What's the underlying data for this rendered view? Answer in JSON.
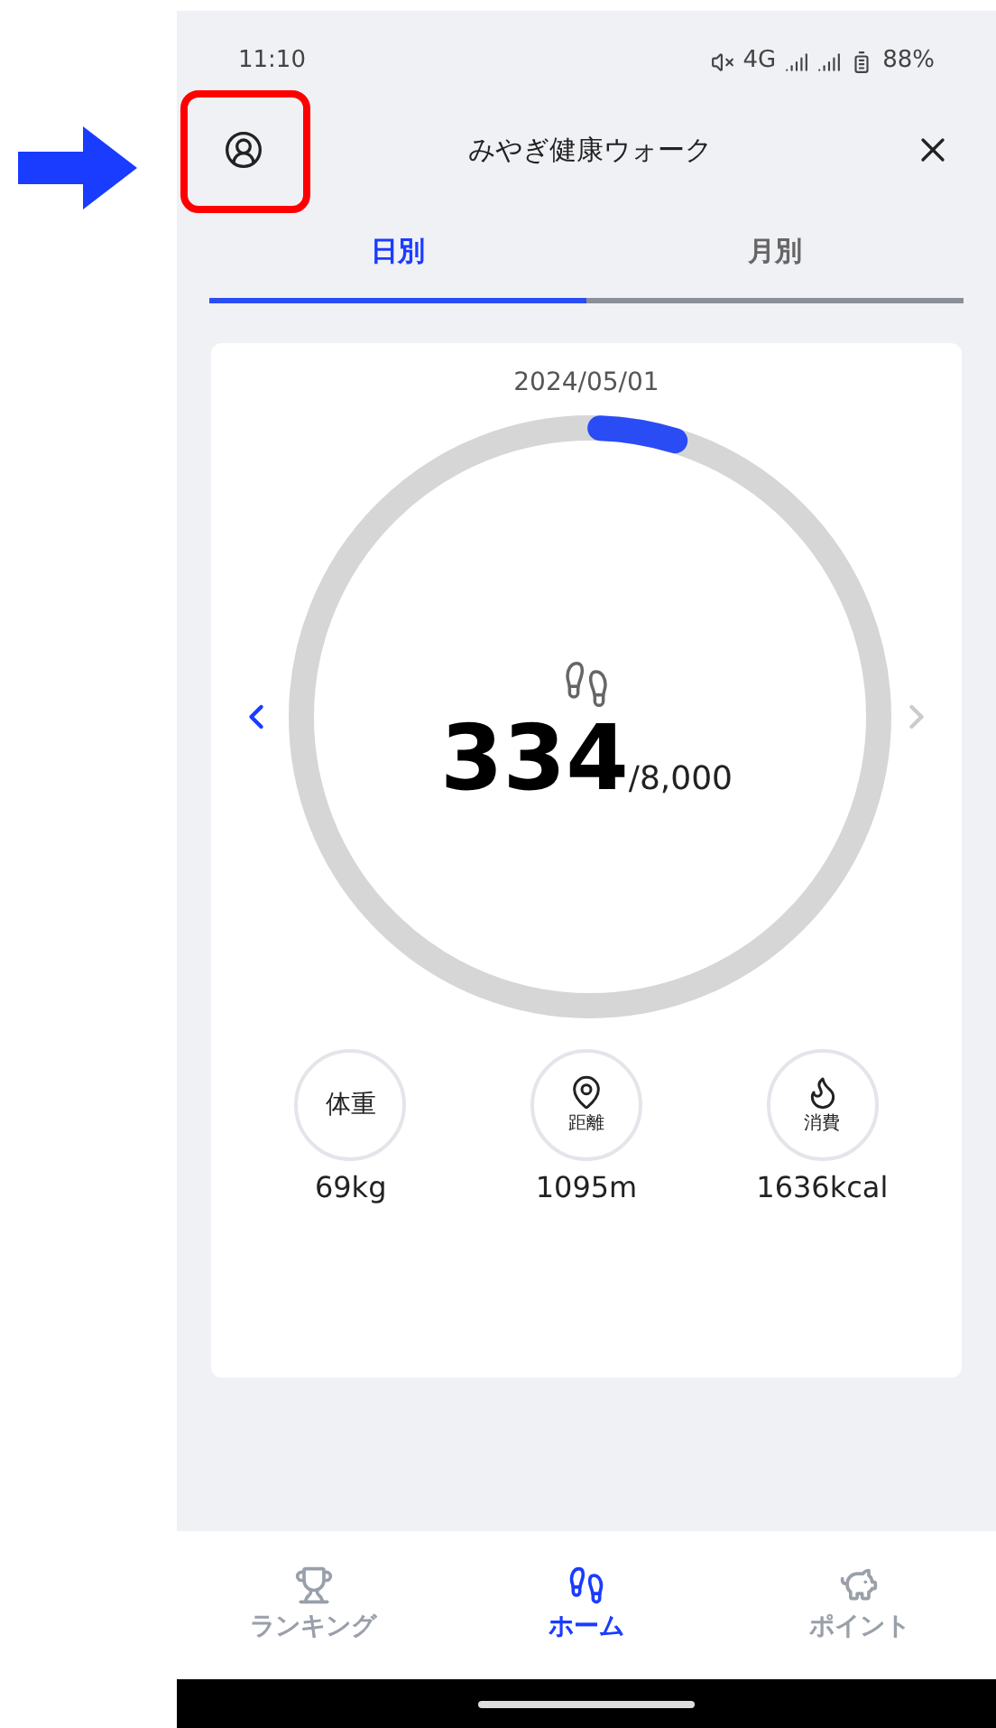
{
  "annotation": {
    "arrow": true,
    "highlight_box": true
  },
  "status_bar": {
    "time": "11:10",
    "network": "4G",
    "battery": "88%",
    "muted": true
  },
  "header": {
    "title": "みやぎ健康ウォーク"
  },
  "tabs": [
    {
      "label": "日別",
      "selected": true
    },
    {
      "label": "月別",
      "selected": false
    }
  ],
  "summary": {
    "date": "2024/05/01",
    "steps": "334",
    "goal": "/8,000",
    "level": 0.042,
    "prev_disabled": false,
    "next_disabled": true
  },
  "stats": [
    {
      "kind": "text",
      "label": "体重",
      "value": "69kg"
    },
    {
      "kind": "distance",
      "label": "距離",
      "value": "1095m"
    },
    {
      "kind": "calories",
      "label": "消費",
      "value": "1636kcal"
    }
  ],
  "bottom_nav": [
    {
      "kind": "ranking",
      "label": "ランキング",
      "selected": false
    },
    {
      "kind": "home",
      "label": "ホーム",
      "selected": true
    },
    {
      "kind": "points",
      "label": "ポイント",
      "selected": false
    }
  ]
}
